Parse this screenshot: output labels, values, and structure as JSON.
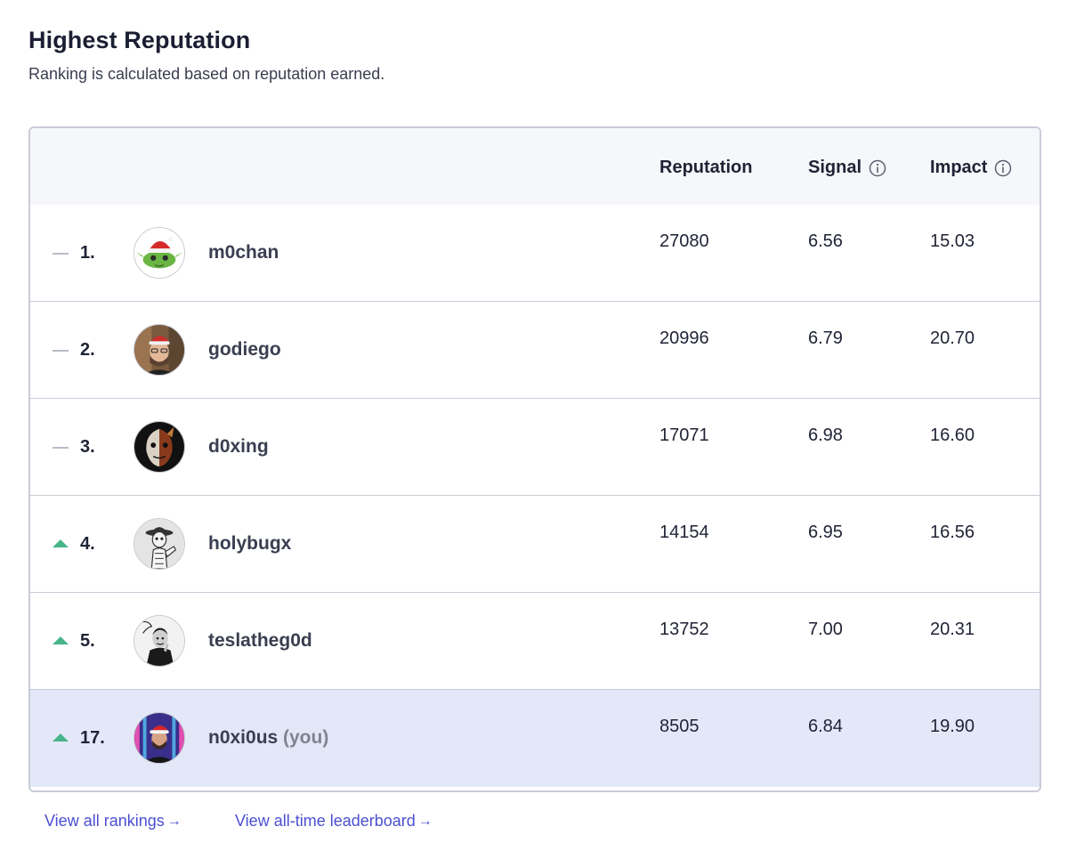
{
  "header": {
    "title": "Highest Reputation",
    "subtitle": "Ranking is calculated based on reputation earned."
  },
  "columns": {
    "reputation": "Reputation",
    "signal": "Signal",
    "impact": "Impact"
  },
  "colors": {
    "trend_up": "#47b589",
    "trend_flat": "#b8bbc7",
    "self_row_bg": "#e3e8f8",
    "link": "#4b4fd1"
  },
  "rows": [
    {
      "trend": "flat",
      "trend_icon": "flat-dash-icon",
      "rank": "1.",
      "username": "m0chan",
      "avatar": "yoda-santa-avatar",
      "reputation": "27080",
      "signal": "6.56",
      "impact": "15.03"
    },
    {
      "trend": "flat",
      "trend_icon": "flat-dash-icon",
      "rank": "2.",
      "username": "godiego",
      "avatar": "man-santa-hat-avatar",
      "reputation": "20996",
      "signal": "6.79",
      "impact": "20.70"
    },
    {
      "trend": "flat",
      "trend_icon": "flat-dash-icon",
      "rank": "3.",
      "username": "d0xing",
      "avatar": "masked-face-avatar",
      "reputation": "17071",
      "signal": "6.98",
      "impact": "16.60"
    },
    {
      "trend": "up",
      "trend_icon": "arrow-up-icon",
      "rank": "4.",
      "username": "holybugx",
      "avatar": "sketch-figure-avatar",
      "reputation": "14154",
      "signal": "6.95",
      "impact": "16.56"
    },
    {
      "trend": "up",
      "trend_icon": "arrow-up-icon",
      "rank": "5.",
      "username": "teslatheg0d",
      "avatar": "tesla-portrait-avatar",
      "reputation": "13752",
      "signal": "7.00",
      "impact": "20.31"
    },
    {
      "trend": "up",
      "trend_icon": "arrow-up-icon",
      "rank": "17.",
      "username": "n0xi0us",
      "you_label": "(you)",
      "avatar": "neon-santa-avatar",
      "reputation": "8505",
      "signal": "6.84",
      "impact": "19.90",
      "is_self": true
    }
  ],
  "footer": {
    "view_all_rankings": "View all rankings",
    "view_all_time": "View all-time leaderboard",
    "arrow": "→"
  }
}
